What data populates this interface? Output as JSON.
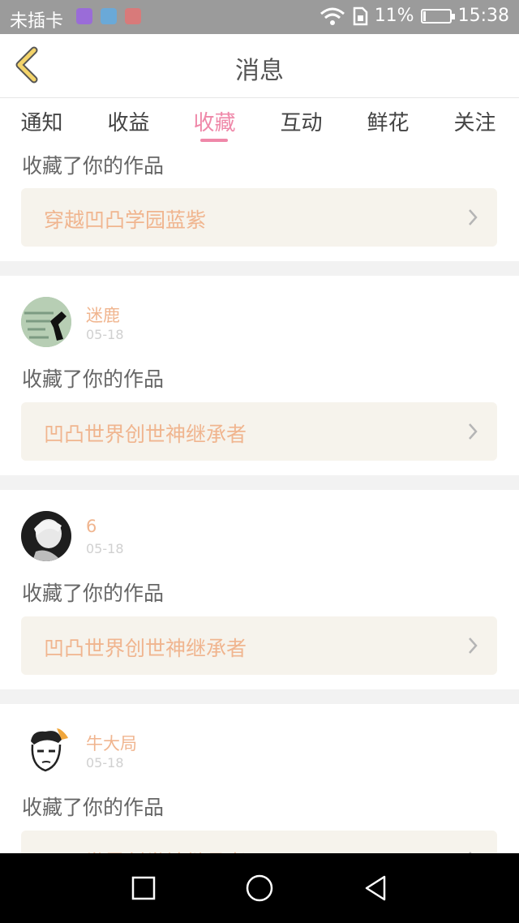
{
  "status_bar": {
    "carrier": "未插卡",
    "battery_percent": "11%",
    "time": "15:38",
    "battery_level": 0.11
  },
  "header": {
    "title": "消息"
  },
  "tabs": [
    {
      "label": "通知"
    },
    {
      "label": "收益"
    },
    {
      "label": "收藏",
      "active": true
    },
    {
      "label": "互动"
    },
    {
      "label": "鲜花"
    },
    {
      "label": "关注"
    }
  ],
  "messages": [
    {
      "action": "收藏了你的作品",
      "work_title": "穿越凹凸学园蓝紫"
    },
    {
      "user": "迷鹿",
      "date": "05-18",
      "action": "收藏了你的作品",
      "work_title": "凹凸世界创世神继承者"
    },
    {
      "user": "6",
      "date": "05-18",
      "action": "收藏了你的作品",
      "work_title": "凹凸世界创世神继承者"
    },
    {
      "user": "牛大局",
      "date": "05-18",
      "action": "收藏了你的作品",
      "work_title": "凹凸世界创世神继承者"
    }
  ],
  "colors": {
    "accent_pink": "#ef88a9",
    "name_orange": "#f0b58f",
    "card_bg": "#f6f3ec",
    "page_bg": "#f2f2f2"
  },
  "icons": {
    "back": "chevron-left-icon",
    "work_arrow": "chevron-right-icon",
    "nav_recents": "square-icon",
    "nav_home": "circle-icon",
    "nav_back": "triangle-back-icon"
  }
}
